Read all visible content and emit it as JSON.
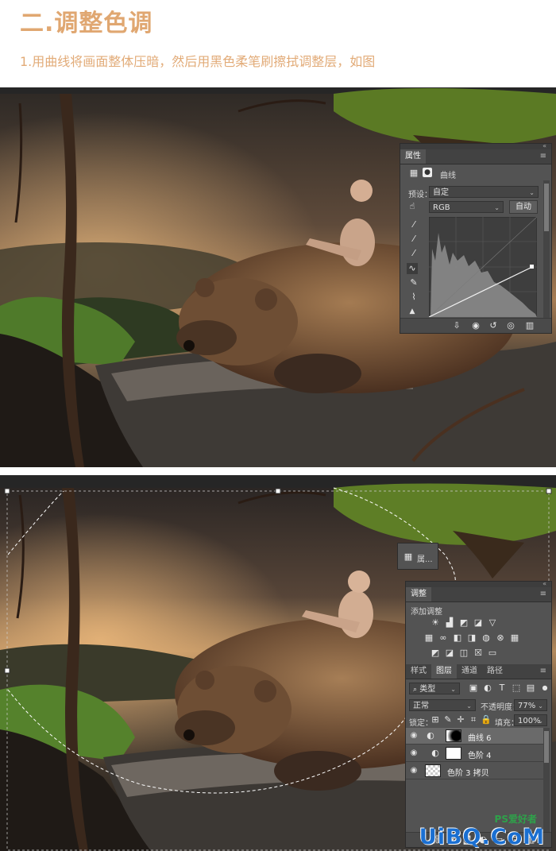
{
  "heading": {
    "title": "二.调整色调",
    "step": "1.用曲线将画面整体压暗，然后用黑色柔笔刷擦拭调整层，如图"
  },
  "colors": {
    "heading": "#e0a771",
    "ps_panel": "#535353",
    "ps_dark": "#424242",
    "watermark": "#1a6fd1"
  },
  "properties_panel": {
    "tab": "属性",
    "layer_type": "曲线",
    "preset_label": "预设：",
    "preset_value": "自定",
    "channel": "RGB",
    "auto_button": "自动",
    "icons": [
      "curves-adjust-icon",
      "mask-icon",
      "hand-target-icon",
      "eyedropper-black-icon",
      "eyedropper-gray-icon",
      "eyedropper-white-icon",
      "curve-point-tool-icon",
      "pencil-icon",
      "smooth-icon",
      "warning-icon"
    ],
    "footer_icons": [
      "clip-icon",
      "view-previous-icon",
      "reset-icon",
      "visibility-icon",
      "trash-icon"
    ]
  },
  "collapsed_properties": {
    "label": "属..."
  },
  "adjustments_panel": {
    "tab": "调整",
    "add_label": "添加调整",
    "icon_rows": [
      [
        "brightness-icon",
        "levels-icon",
        "curves-icon",
        "exposure-icon",
        "triangle-icon"
      ],
      [
        "vibrance-icon",
        "hue-sat-icon",
        "color-balance-icon",
        "bw-icon",
        "photo-filter-icon",
        "channel-mixer-icon",
        "color-lookup-icon"
      ],
      [
        "invert-icon",
        "posterize-icon",
        "threshold-icon",
        "selective-color-icon",
        "gradient-map-icon"
      ]
    ]
  },
  "layers_panel": {
    "tabs": [
      "样式",
      "图层",
      "通道",
      "路径"
    ],
    "active_tab": "图层",
    "filter_kind": "类型",
    "blend_mode": "正常",
    "opacity_label": "不透明度：",
    "opacity_value": "77%",
    "lock_label": "锁定：",
    "fill_label": "填充：",
    "fill_value": "100%",
    "layers": [
      {
        "name": "曲线 6",
        "selected": true
      },
      {
        "name": "色阶 4",
        "selected": false
      },
      {
        "name": "色阶 3 拷贝",
        "selected": false
      }
    ],
    "footer_icons": [
      "link-icon",
      "fx-icon",
      "add-mask-icon",
      "new-fill-icon",
      "group-icon",
      "new-layer-icon",
      "trash-icon"
    ]
  },
  "watermark": {
    "text": "UiBQ.CoM",
    "small": "PS爱好者"
  }
}
